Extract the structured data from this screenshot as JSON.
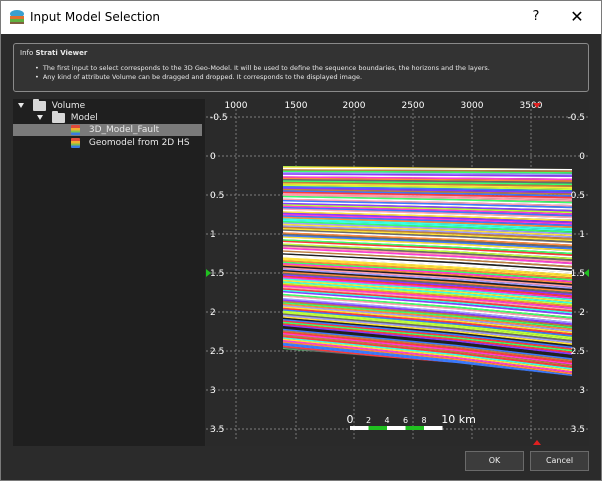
{
  "window": {
    "title": "Input Model Selection",
    "help_glyph": "?",
    "close_glyph": "✕"
  },
  "info": {
    "prefix": "Info",
    "heading": "Strati Viewer",
    "bullets": [
      "The first input to select corresponds to the 3D Geo-Model. It will be used to define the sequence boundaries, the horizons and the layers.",
      "Any kind of attribute Volume can be dragged and dropped. It corresponds to the displayed image."
    ]
  },
  "tree": {
    "root_label": "Volume",
    "child_label": "Model",
    "items": [
      "3D_Model_Fault",
      "Geomodel from 2D HS"
    ],
    "selected_index": 0
  },
  "viewer": {
    "x_ticks": [
      "1000",
      "1500",
      "2000",
      "2500",
      "3000",
      "3500"
    ],
    "y_ticks": [
      "-0.5",
      "0",
      "0.5",
      "1",
      "1.5",
      "2",
      "2.5",
      "3",
      "3.5"
    ],
    "scale_ticks": [
      "0",
      "2",
      "4",
      "6",
      "8",
      "10 km"
    ],
    "colors": {
      "grid": "#9a9a9a",
      "marker_red": "#e02020",
      "marker_green": "#20c020"
    }
  },
  "buttons": {
    "ok": "OK",
    "cancel": "Cancel"
  }
}
